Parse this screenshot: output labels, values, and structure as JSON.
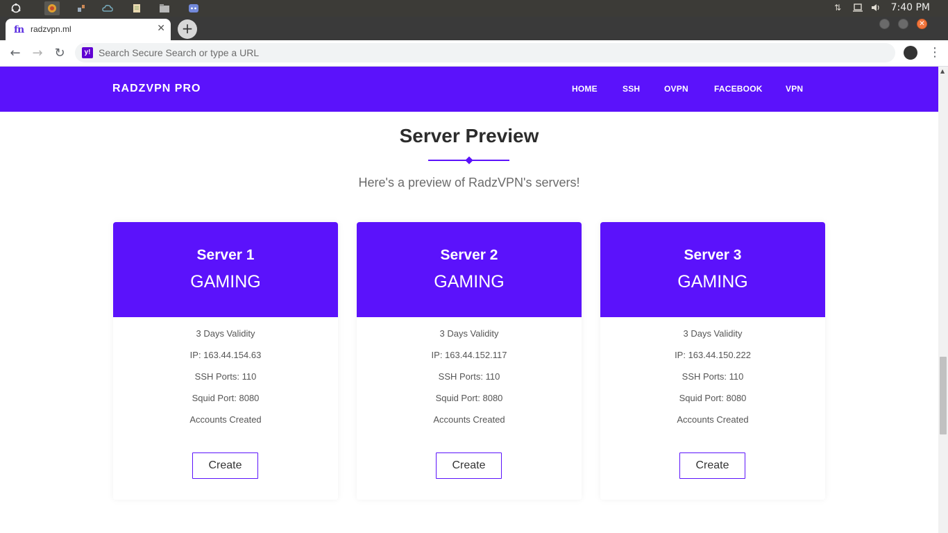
{
  "os_panel": {
    "clock": "7:40 PM"
  },
  "browser": {
    "tab_title": "radzvpn.ml",
    "tab_favicon": "fn",
    "omnibox_placeholder": "Search Secure Search or type a URL",
    "search_engine_badge": "y!"
  },
  "site": {
    "brand": "RADZVPN PRO",
    "nav": [
      "HOME",
      "SSH",
      "OVPN",
      "FACEBOOK",
      "VPN"
    ],
    "section_title": "Server Preview",
    "section_subtitle": "Here's a preview of RadzVPN's servers!",
    "brand_color": "#5b12fb"
  },
  "servers": [
    {
      "name": "Server 1",
      "type": "GAMING",
      "validity": "3 Days Validity",
      "ip": "IP: 163.44.154.63",
      "ssh_ports": "SSH Ports: 110",
      "squid_port": "Squid Port: 8080",
      "accounts": "Accounts Created",
      "button": "Create"
    },
    {
      "name": "Server 2",
      "type": "GAMING",
      "validity": "3 Days Validity",
      "ip": "IP: 163.44.152.117",
      "ssh_ports": "SSH Ports: 110",
      "squid_port": "Squid Port: 8080",
      "accounts": "Accounts Created",
      "button": "Create"
    },
    {
      "name": "Server 3",
      "type": "GAMING",
      "validity": "3 Days Validity",
      "ip": "IP: 163.44.150.222",
      "ssh_ports": "SSH Ports: 110",
      "squid_port": "Squid Port: 8080",
      "accounts": "Accounts Created",
      "button": "Create"
    }
  ]
}
